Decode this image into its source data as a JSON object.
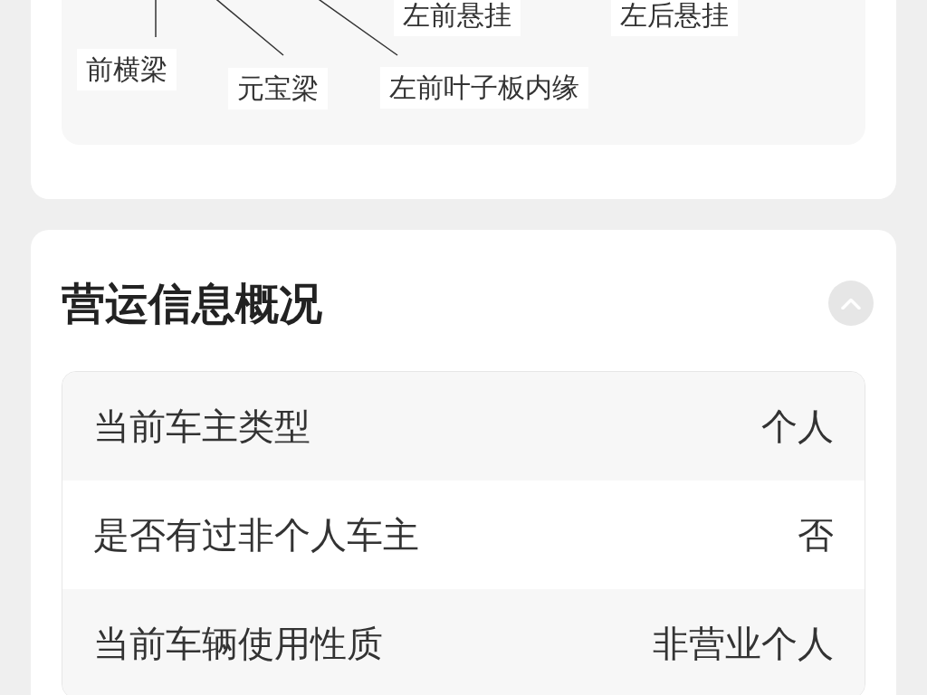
{
  "diagram": {
    "labels": [
      {
        "text": "左前悬挂"
      },
      {
        "text": "左后悬挂"
      },
      {
        "text": "前横梁"
      },
      {
        "text": "元宝梁"
      },
      {
        "text": "左前叶子板内缘"
      }
    ]
  },
  "operation_section": {
    "title": "营运信息概况",
    "expanded": true,
    "rows": [
      {
        "label": "当前车主类型",
        "value": "个人"
      },
      {
        "label": "是否有过非个人车主",
        "value": "否"
      },
      {
        "label": "当前车辆使用性质",
        "value": "非营业个人"
      }
    ]
  }
}
